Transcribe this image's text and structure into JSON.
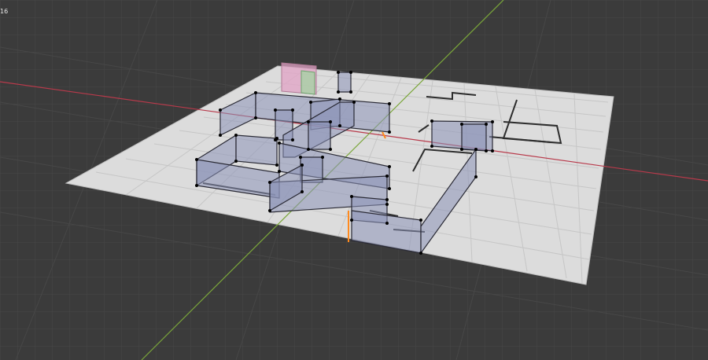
{
  "viewport": {
    "corner_text": "16",
    "colors": {
      "background": "#3b3b3b",
      "grid_floor": "#464646",
      "plane_fill": "#dcdcdc",
      "plane_grid": "#c4c4c4",
      "x_axis": "#b83a4b",
      "y_axis": "#7aa63a",
      "wall_fill": "#8c93b8",
      "wall_edge": "#2a2a35",
      "vertex": "#000000",
      "selected_edge": "#ff8a1e",
      "pink_face": "#e2a3c6",
      "green_face": "#9fd69f"
    }
  }
}
